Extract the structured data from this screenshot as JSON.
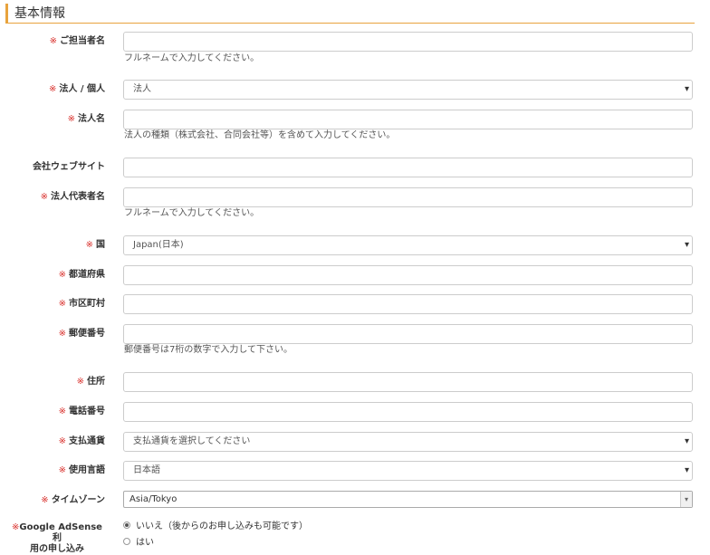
{
  "section_title": "基本情報",
  "required_mark": "※",
  "fields": {
    "contact_name": {
      "label": "ご担当者名",
      "value": "",
      "help": "フルネームで入力してください。"
    },
    "entity_type": {
      "label": "法人 / 個人",
      "value": "法人"
    },
    "company_name": {
      "label": "法人名",
      "value": "",
      "help": "法人の種類（株式会社、合同会社等）を含めて入力してください。"
    },
    "website": {
      "label": "会社ウェブサイト",
      "value": ""
    },
    "representative": {
      "label": "法人代表者名",
      "value": "",
      "help": "フルネームで入力してください。"
    },
    "country": {
      "label": "国",
      "value": "Japan(日本)"
    },
    "prefecture": {
      "label": "都道府県",
      "value": ""
    },
    "city": {
      "label": "市区町村",
      "value": ""
    },
    "postal_code": {
      "label": "郵便番号",
      "value": "",
      "help": "郵便番号は7桁の数字で入力して下さい。"
    },
    "address": {
      "label": "住所",
      "value": ""
    },
    "phone": {
      "label": "電話番号",
      "value": ""
    },
    "currency": {
      "label": "支払通貨",
      "value": "支払通貨を選択してください"
    },
    "language": {
      "label": "使用言語",
      "value": "日本語"
    },
    "timezone": {
      "label": "タイムゾーン",
      "value": "Asia/Tokyo"
    },
    "adsense": {
      "label_line1": "Google AdSense 利",
      "label_line2": "用の申し込み",
      "options": [
        "いいえ（後からのお申し込みも可能です）",
        "はい"
      ]
    }
  }
}
